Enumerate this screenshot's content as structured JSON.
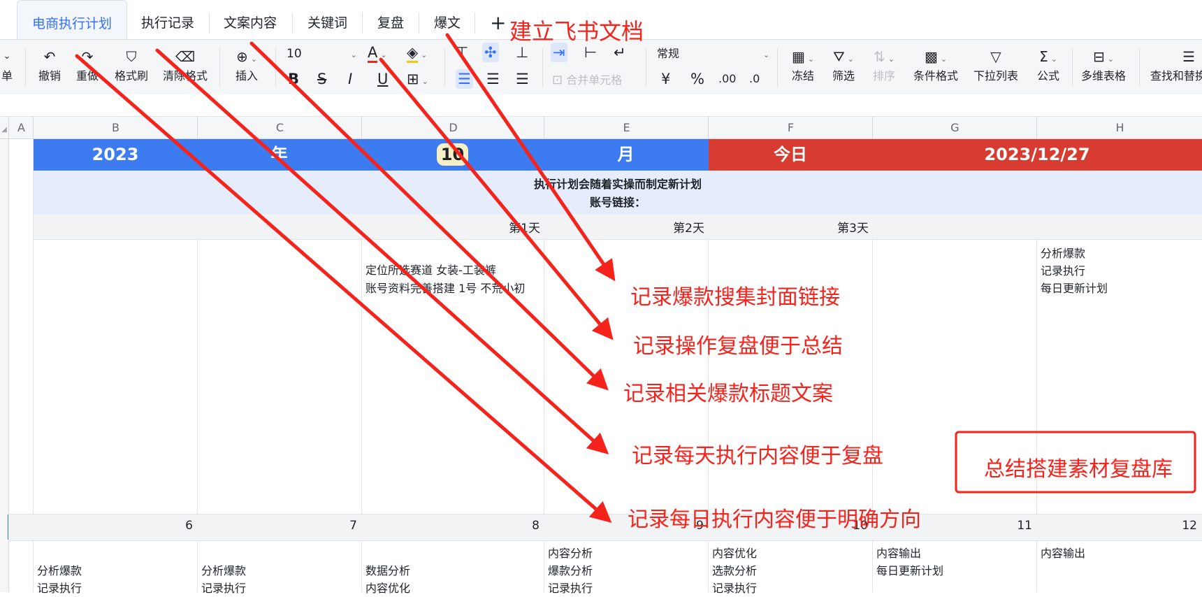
{
  "tabs": [
    "电商执行计划",
    "执行记录",
    "文案内容",
    "关键词",
    "复盘",
    "爆文"
  ],
  "add_tab": "+",
  "toolbar": {
    "partial_left": "单",
    "undo": "撤销",
    "redo": "重做",
    "format_painter": "格式刷",
    "clear_format": "清除格式",
    "insert": "插入",
    "font_size": "10",
    "bold": "B",
    "strike": "S",
    "italic": "I",
    "underline": "U",
    "font_color": "A",
    "merge_cells": "合并单元格",
    "number_format": "常规",
    "currency": "¥",
    "percent": "%",
    "dec_increase": ".00",
    "dec_decrease": ".0",
    "freeze": "冻结",
    "filter": "筛选",
    "sort": "排序",
    "conditional_format": "条件格式",
    "dropdown_list": "下拉列表",
    "formula": "公式",
    "pivot": "多维表格",
    "find_replace": "查找和替换"
  },
  "columns": [
    "A",
    "B",
    "C",
    "D",
    "E",
    "F",
    "G",
    "H"
  ],
  "banner": {
    "year": "2023",
    "year_unit": "年",
    "month": "10",
    "month_unit": "月",
    "today_label": "今日",
    "today_date": "2023/12/27"
  },
  "notice": {
    "line1": "执行计划会随着实操而制定新计划",
    "line2": "账号链接："
  },
  "day_labels": [
    "第1天",
    "第2天",
    "第3天"
  ],
  "row1": {
    "d_line1": "定位所选赛道 女装-工装裤",
    "d_line2": "账号资料完善搭建 1号 不荒小初",
    "h_line1": "分析爆款",
    "h_line2": "记录执行",
    "h_line3": "每日更新计划"
  },
  "date_numbers": [
    "6",
    "7",
    "8",
    "9",
    "10",
    "11",
    "12"
  ],
  "row2": {
    "b1": "分析爆款",
    "b2": "记录执行",
    "c1": "分析爆款",
    "c2": "记录执行",
    "d1": "数据分析",
    "d2": "内容优化",
    "e1": "内容分析",
    "e2": "爆款分析",
    "e3": "记录执行",
    "f1": "内容优化",
    "f2": "选款分析",
    "f3": "记录执行",
    "g1": "内容输出",
    "g2": "每日更新计划",
    "h1": "内容输出"
  },
  "annotations": {
    "title": "建立飞书文档",
    "n1": "记录爆款搜集封面链接",
    "n2": "记录操作复盘便于总结",
    "n3": "记录相关爆款标题文案",
    "n4": "记录每天执行内容便于复盘",
    "n5": "记录每日执行内容便于明确方向",
    "box": "总结搭建素材复盘库"
  },
  "colors": {
    "accent": "#3370ff",
    "banner_blue": "#3d7bf0",
    "banner_red": "#d83b30",
    "annotation_red": "#f5231c",
    "notice_bg": "#e5ecfb"
  }
}
